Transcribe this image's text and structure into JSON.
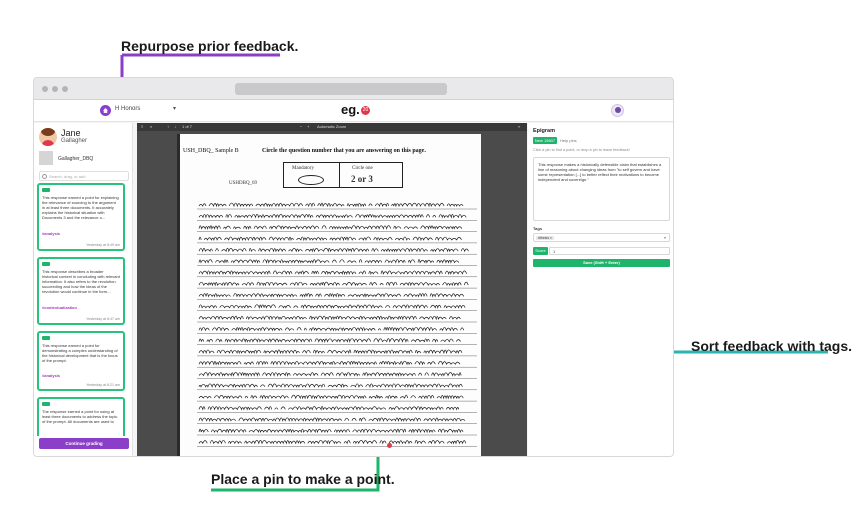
{
  "callouts": {
    "feedback": "Repurpose prior feedback.",
    "tags": "Sort feedback with tags.",
    "pin": "Place a pin to make a point."
  },
  "colors": {
    "purple": "#8b3fc9",
    "teal": "#2ab3b1",
    "green": "#1fb46b"
  },
  "app": {
    "course": "H Honors",
    "logo": "eg.",
    "logo_badge": "20"
  },
  "student": {
    "first_name": "Jane",
    "last_name": "Gallagher",
    "document": "Gallagher_DBQ"
  },
  "search": {
    "placeholder": "Search, drag, or add"
  },
  "cards": [
    {
      "badge": "1",
      "text": "This response earned a point for explaining the relevance of sourcing to the argument in at least three documents. It accurately explains the historical situation with Documents 3 and the relevance o...",
      "tag": "#analysis",
      "when": "Yesterday at 8:49 am"
    },
    {
      "badge": "1",
      "text": "This response describes a broader historical context in concluding with relevant information. It also refers to the revolution succeeding and how the ideas of the revolution would continue in the form...",
      "tag": "#contextualization",
      "when": "Yesterday at 8:47 am"
    },
    {
      "badge": "1",
      "text": "This response earned a point for demonstrating a complex understanding of the historical development that is the focus of the prompt.",
      "tag": "#analysis",
      "when": "Yesterday at 8:21 am"
    },
    {
      "badge": "1",
      "text": "The response earned a point for using at least three documents to address the topic of the prompt. All documents are used to",
      "tag": "",
      "when": ""
    }
  ],
  "continue_label": "Continue grading",
  "viewer": {
    "page_indicator": "1 of 7",
    "zoom": "Automatic Zoom"
  },
  "doc": {
    "header": "USH_DBQ_ Sample B",
    "instruction": "Circle the question number that you are answering on this page.",
    "mandatory": "Mandatory",
    "circle_one": "Circle one",
    "choice": "2  or  3",
    "doc_id": "USHDBQ_69"
  },
  "panel": {
    "title": "Epigram",
    "tab_new": "New 15607",
    "tab_help": "Help pins",
    "hint": "Click a pin to find a point, or drop a pin to leave feedback!",
    "feedback": "This response makes a historically defensible claim that establishes a line of reasoning about changing ideas from \"to self govern and have some representation [...] to better reflect their motivations to become independent and sovereign.\"",
    "tags_label": "Tags",
    "tag_chip": "#thesis ×",
    "score_label": "Score",
    "score_value": "1",
    "save_label": "Save (Shift + Enter)"
  }
}
